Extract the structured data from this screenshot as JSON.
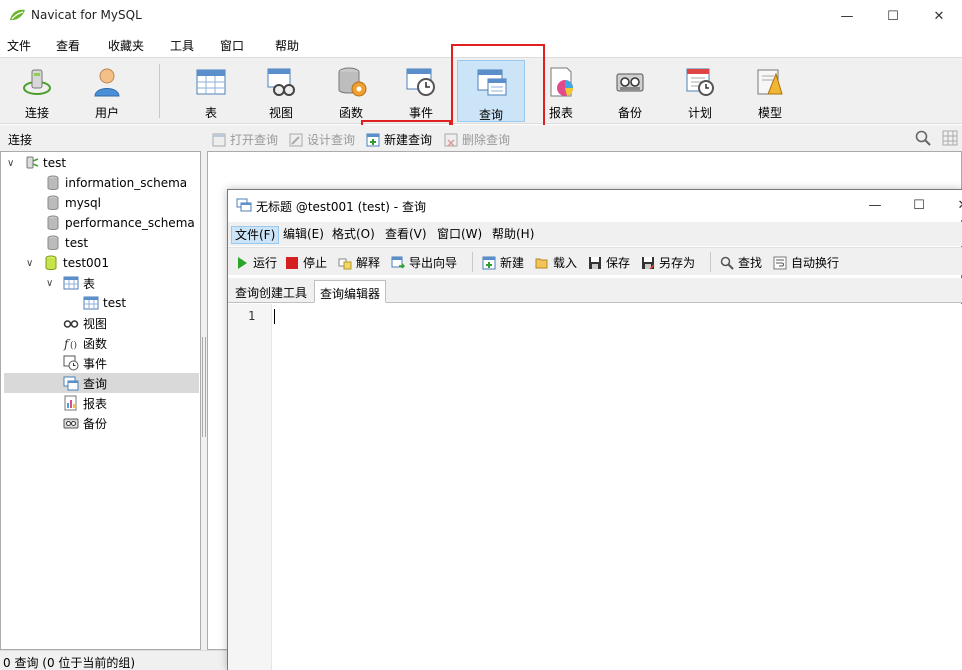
{
  "app": {
    "title": "Navicat for MySQL",
    "window_controls": {
      "minimize": "—",
      "maximize": "☐",
      "close": "✕"
    }
  },
  "menu": [
    "文件",
    "查看",
    "收藏夹",
    "工具",
    "窗口",
    "帮助"
  ],
  "toolbar": {
    "items": [
      {
        "label": "连接",
        "icon": "connection-icon"
      },
      {
        "label": "用户",
        "icon": "user-icon"
      },
      {
        "label": "表",
        "icon": "table-icon"
      },
      {
        "label": "视图",
        "icon": "view-icon"
      },
      {
        "label": "函数",
        "icon": "function-icon"
      },
      {
        "label": "事件",
        "icon": "event-icon"
      },
      {
        "label": "查询",
        "icon": "query-icon",
        "active": true
      },
      {
        "label": "报表",
        "icon": "report-icon"
      },
      {
        "label": "备份",
        "icon": "backup-icon"
      },
      {
        "label": "计划",
        "icon": "schedule-icon"
      },
      {
        "label": "模型",
        "icon": "model-icon"
      }
    ]
  },
  "subtoolbar": {
    "section_label": "连接",
    "items": [
      {
        "label": "打开查询",
        "enabled": false
      },
      {
        "label": "设计查询",
        "enabled": false
      },
      {
        "label": "新建查询",
        "enabled": true
      },
      {
        "label": "删除查询",
        "enabled": false
      }
    ]
  },
  "tree": {
    "connection": "test",
    "databases_top": [
      "information_schema",
      "mysql",
      "performance_schema",
      "test"
    ],
    "open_db": "test001",
    "open_db_children": [
      {
        "label": "表",
        "expanded": true
      },
      {
        "label": "test",
        "child": true
      },
      {
        "label": "视图"
      },
      {
        "label": "函数"
      },
      {
        "label": "事件"
      },
      {
        "label": "查询",
        "selected": true
      },
      {
        "label": "报表"
      },
      {
        "label": "备份"
      }
    ]
  },
  "statusbar": {
    "text": "0 查询 (0 位于当前的组)"
  },
  "query_window": {
    "title": "无标题 @test001 (test) - 查询",
    "menu": [
      "文件(F)",
      "编辑(E)",
      "格式(O)",
      "查看(V)",
      "窗口(W)",
      "帮助(H)"
    ],
    "toolbar": [
      "运行",
      "停止",
      "解释",
      "导出向导",
      "新建",
      "载入",
      "保存",
      "另存为",
      "查找",
      "自动换行"
    ],
    "tabs": [
      "查询创建工具",
      "查询编辑器"
    ],
    "active_tab": "查询编辑器",
    "editor": {
      "line_number": "1",
      "content": ""
    }
  },
  "colors": {
    "accent": "#cce4f7",
    "annotation": "#e02020",
    "chrome": "#f0f0f0"
  }
}
